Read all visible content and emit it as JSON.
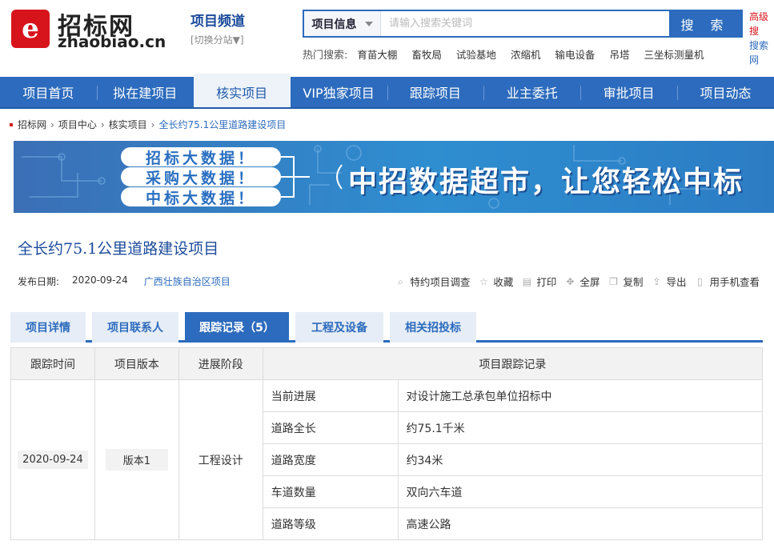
{
  "brand": {
    "logo_cn": "招标网",
    "logo_en": "zhaobiao.cn",
    "channel_title": "项目频道",
    "channel_switch": "[切换分站▼]"
  },
  "search": {
    "category": "项目信息",
    "placeholder": "请输入搜索关键词",
    "button": "搜 索",
    "advanced": "高级搜",
    "advanced_sub": "搜索网"
  },
  "hot_searches": {
    "label": "热门搜索:",
    "items": [
      "育苗大棚",
      "畜牧局",
      "试验基地",
      "浓缩机",
      "输电设备",
      "吊塔",
      "三坐标测量机"
    ]
  },
  "nav": [
    "项目首页",
    "拟在建项目",
    "核实项目",
    "VIP独家项目",
    "跟踪项目",
    "业主委托",
    "审批项目",
    "项目动态"
  ],
  "breadcrumb": [
    "招标网",
    "项目中心",
    "核实项目",
    "全长约75.1公里道路建设项目"
  ],
  "banner": {
    "pills": [
      "招标大数据！",
      "采购大数据！",
      "中标大数据！"
    ],
    "slogan": "中招数据超市，让您轻松中标"
  },
  "project": {
    "title": "全长约75.1公里道路建设项目",
    "date_label": "发布日期:",
    "date": "2020-09-24",
    "region": "广西壮族自治区项目"
  },
  "tools": [
    {
      "icon": "magnifier-icon",
      "label": "特约项目调查"
    },
    {
      "icon": "star-icon",
      "label": "收藏"
    },
    {
      "icon": "printer-icon",
      "label": "打印"
    },
    {
      "icon": "move-icon",
      "label": "全屏"
    },
    {
      "icon": "copy-icon",
      "label": "复制"
    },
    {
      "icon": "export-icon",
      "label": "导出"
    },
    {
      "icon": "mobile-icon",
      "label": "用手机查看"
    }
  ],
  "tabs": [
    "项目详情",
    "项目联系人",
    "跟踪记录（5）",
    "工程及设备",
    "相关招投标"
  ],
  "table": {
    "headers": [
      "跟踪时间",
      "项目版本",
      "进展阶段",
      "项目跟踪记录"
    ],
    "time": "2020-09-24",
    "version": "版本1",
    "stage": "工程设计",
    "records": [
      {
        "key": "当前进展",
        "value": "对设计施工总承包单位招标中"
      },
      {
        "key": "道路全长",
        "value": "约75.1千米"
      },
      {
        "key": "道路宽度",
        "value": "约34米"
      },
      {
        "key": "车道数量",
        "value": "双向六车道"
      },
      {
        "key": "道路等级",
        "value": "高速公路"
      }
    ]
  }
}
